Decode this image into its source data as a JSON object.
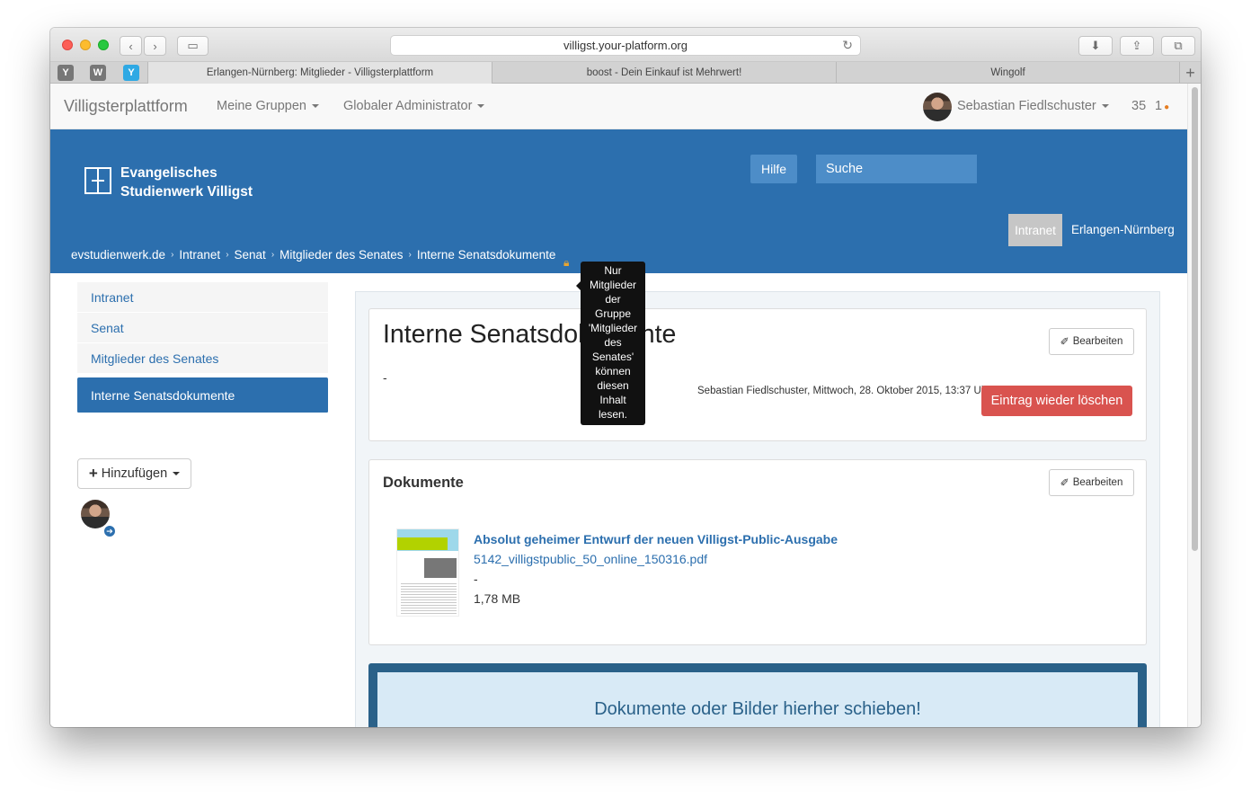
{
  "browser": {
    "url": "villigst.your-platform.org",
    "tabs": [
      {
        "label": "Erlangen-Nürnberg: Mitglieder - Villigsterplattform"
      },
      {
        "label": "boost - Dein Einkauf ist Mehrwert!"
      },
      {
        "label": "Wingolf"
      }
    ],
    "pinned": [
      "Y",
      "W",
      "Y"
    ]
  },
  "navbar": {
    "brand": "Villigsterplattform",
    "menu_groups": "Meine Gruppen",
    "menu_admin": "Globaler Administrator",
    "user_name": "Sebastian Fiedlschuster",
    "count_a": "35",
    "count_b": "1"
  },
  "header": {
    "logo_line1": "Evangelisches",
    "logo_line2": "Studienwerk Villigst",
    "help_label": "Hilfe",
    "search_placeholder": "Suche",
    "intranet_label": "Intranet",
    "erlangen_label": "Erlangen-Nürnberg",
    "breadcrumb": [
      "evstudienwerk.de",
      "Intranet",
      "Senat",
      "Mitglieder des Senates",
      "Interne Senatsdokumente"
    ],
    "tooltip_lines": [
      "Nur",
      "Mitglieder",
      "der",
      "Gruppe",
      "'Mitglieder",
      "des",
      "Senates'",
      "können",
      "diesen",
      "Inhalt",
      "lesen."
    ]
  },
  "sidebar": {
    "items": [
      {
        "label": "Intranet"
      },
      {
        "label": "Senat"
      },
      {
        "label": "Mitglieder des Senates"
      },
      {
        "label": "Interne Senatsdokumente"
      }
    ],
    "add_label": "Hinzufügen"
  },
  "main": {
    "title": "Interne Senatsdokumente",
    "edit_label": "Bearbeiten",
    "body": "-",
    "meta": "Sebastian Fiedlschuster, Mittwoch, 28. Oktober 2015, 13:37 Uhr",
    "delete_label": "Eintrag wieder löschen",
    "documents": {
      "title": "Dokumente",
      "edit_label": "Bearbeiten",
      "item": {
        "title": "Absolut geheimer Entwurf der neuen Villigst-Public-Ausgabe",
        "filename": "5142_villigstpublic_50_online_150316.pdf",
        "description": "-",
        "size": "1,78 MB"
      }
    },
    "dropzone": "Dokumente oder Bilder hierher schieben!"
  },
  "colors": {
    "primary": "#2c6fae",
    "danger": "#d9534f",
    "dropzone_border": "#2a6189"
  }
}
